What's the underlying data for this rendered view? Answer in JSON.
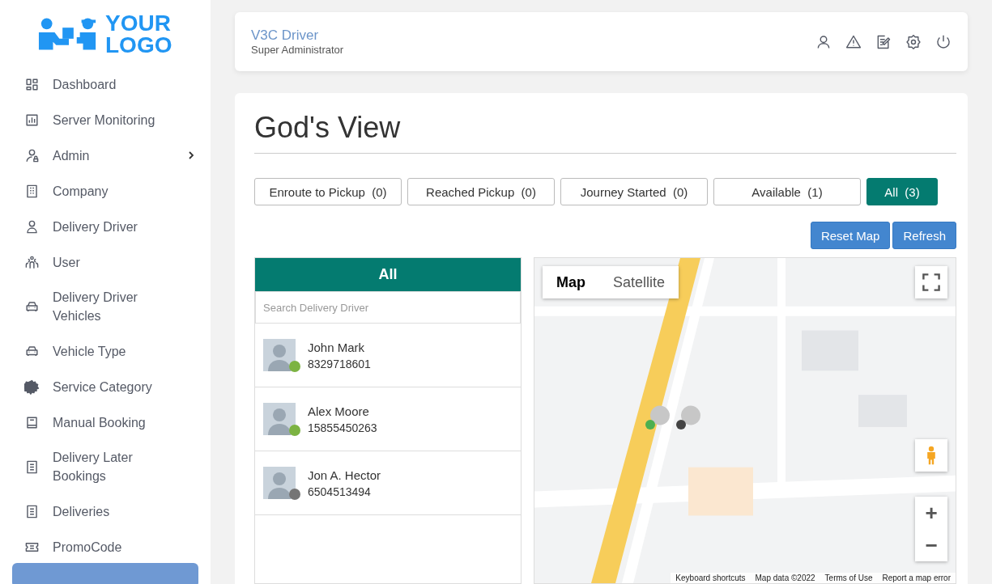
{
  "logo": {
    "line_1": "YOUR",
    "line_2": "LOGO"
  },
  "sidebar": {
    "items": [
      {
        "label": "Dashboard",
        "has_submenu": false
      },
      {
        "label": "Server Monitoring",
        "has_submenu": false
      },
      {
        "label": "Admin",
        "has_submenu": true
      },
      {
        "label": "Company",
        "has_submenu": false
      },
      {
        "label": "Delivery Driver",
        "has_submenu": false
      },
      {
        "label": "User",
        "has_submenu": false
      },
      {
        "label": "Delivery Driver Vehicles",
        "has_submenu": false
      },
      {
        "label": "Vehicle Type",
        "has_submenu": false
      },
      {
        "label": "Service Category",
        "has_submenu": false
      },
      {
        "label": "Manual Booking",
        "has_submenu": false
      },
      {
        "label": "Delivery Later Bookings",
        "has_submenu": false
      },
      {
        "label": "Deliveries",
        "has_submenu": false
      },
      {
        "label": "PromoCode",
        "has_submenu": false
      }
    ]
  },
  "header": {
    "title": "V3C Driver",
    "subtitle": "Super Administrator"
  },
  "page": {
    "title": "God's View"
  },
  "filters": [
    {
      "label": "Enroute to Pickup",
      "count": "(0)",
      "selected": false
    },
    {
      "label": "Reached Pickup",
      "count": "(0)",
      "selected": false
    },
    {
      "label": "Journey Started",
      "count": "(0)",
      "selected": false
    },
    {
      "label": "Available",
      "count": "(1)",
      "selected": false
    },
    {
      "label": "All",
      "count": "(3)",
      "selected": true
    }
  ],
  "actions": [
    "Reset Map",
    "Refresh"
  ],
  "driver_panel": {
    "title": "All",
    "search": {
      "placeholder": "Search Delivery Driver"
    },
    "drivers": [
      {
        "name": "John Mark",
        "phone": "8329718601",
        "color": "#7cb342"
      },
      {
        "name": "Alex Moore",
        "phone": "15855450263",
        "color": "#7cb342"
      },
      {
        "name": "Jon A. Hector",
        "phone": "6504513494",
        "color": "#757575"
      }
    ]
  },
  "map": {
    "types": [
      {
        "label": "Map",
        "selected": true
      },
      {
        "label": "Satellite",
        "selected": false
      }
    ],
    "zoom_in": "+",
    "zoom_out": "−",
    "footer": [
      "Keyboard shortcuts",
      "Map data ©2022",
      "Terms of Use",
      "Report a map error"
    ]
  }
}
